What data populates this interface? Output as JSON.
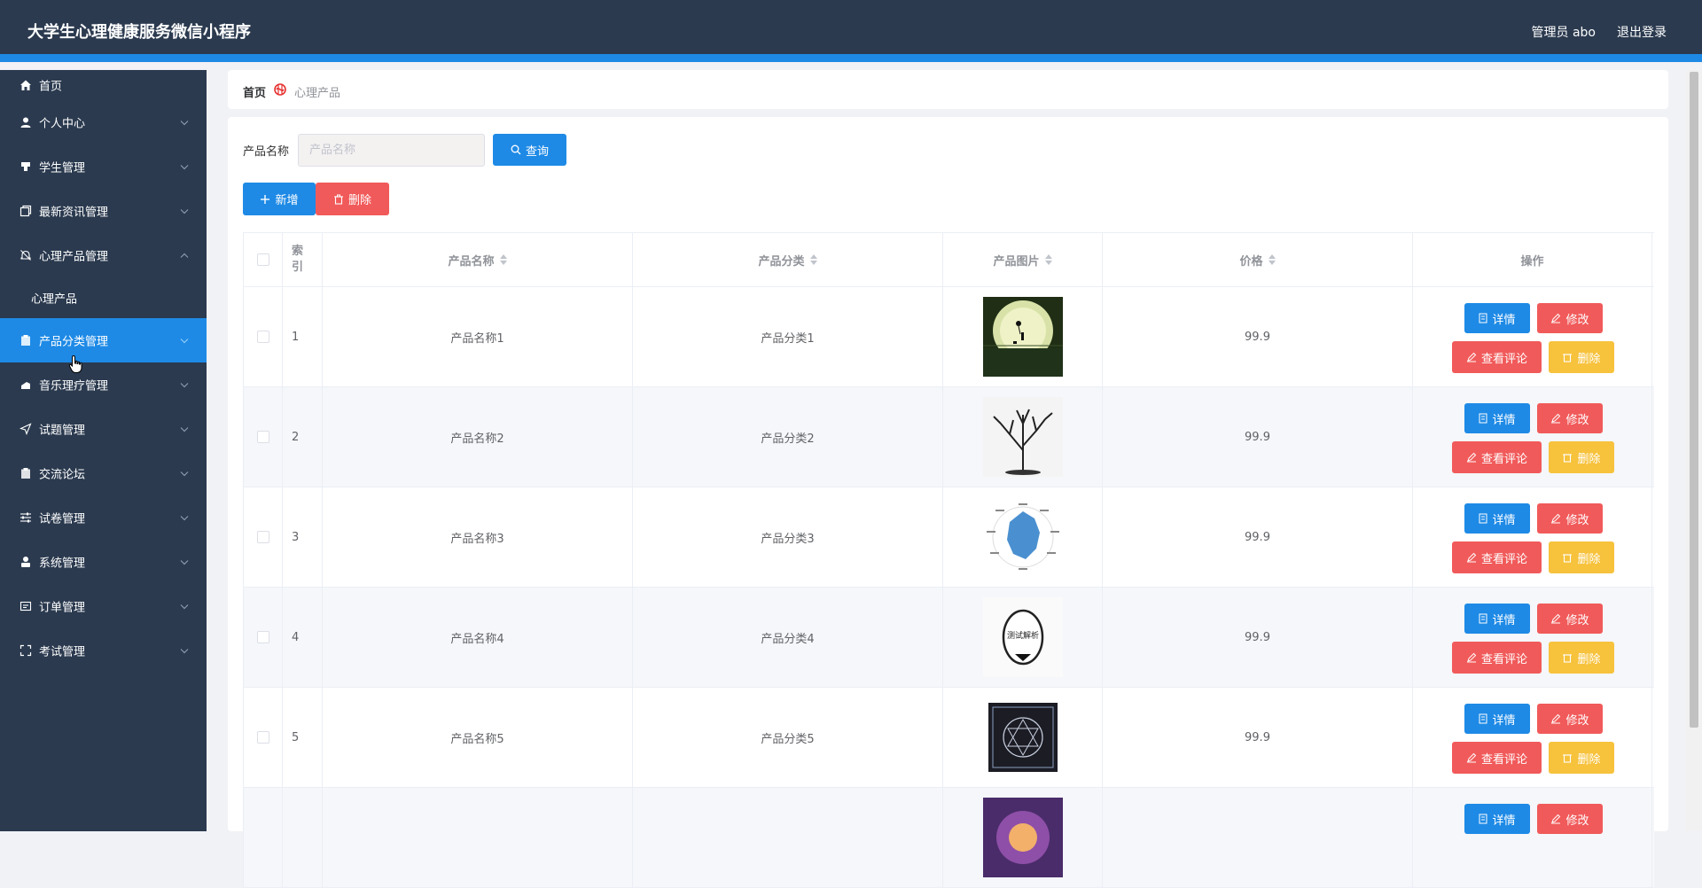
{
  "header": {
    "app_title": "大学生心理健康服务微信小程序",
    "admin_label": "管理员 abo",
    "logout_label": "退出登录"
  },
  "sidebar": {
    "items": [
      {
        "label": "首页",
        "icon": "home-icon"
      },
      {
        "label": "个人中心",
        "icon": "user-icon"
      },
      {
        "label": "学生管理",
        "icon": "student-icon"
      },
      {
        "label": "最新资讯管理",
        "icon": "news-icon"
      },
      {
        "label": "心理产品管理",
        "icon": "bell-icon"
      },
      {
        "label": "产品分类管理",
        "icon": "clipboard-icon"
      },
      {
        "label": "音乐理疗管理",
        "icon": "music-icon"
      },
      {
        "label": "试题管理",
        "icon": "send-icon"
      },
      {
        "label": "交流论坛",
        "icon": "clipboard-icon"
      },
      {
        "label": "试卷管理",
        "icon": "sliders-icon"
      },
      {
        "label": "系统管理",
        "icon": "person-icon"
      },
      {
        "label": "订单管理",
        "icon": "order-icon"
      },
      {
        "label": "考试管理",
        "icon": "fullscreen-icon"
      }
    ],
    "sub_item": "心理产品",
    "active_item": "产品分类管理"
  },
  "breadcrumb": {
    "home": "首页",
    "current": "心理产品"
  },
  "search": {
    "label": "产品名称",
    "placeholder": "产品名称",
    "value": "",
    "query_button": "查询"
  },
  "actions": {
    "add_button": "新增",
    "delete_button": "删除"
  },
  "table": {
    "headers": {
      "index": "索引",
      "name": "产品名称",
      "category": "产品分类",
      "image": "产品图片",
      "price": "价格",
      "ops": "操作"
    },
    "rows": [
      {
        "index": "1",
        "name": "产品名称1",
        "category": "产品分类1",
        "price": "99.9",
        "image": "moon-silhouette"
      },
      {
        "index": "2",
        "name": "产品名称2",
        "category": "产品分类2",
        "price": "99.9",
        "image": "bare-tree"
      },
      {
        "index": "3",
        "name": "产品名称3",
        "category": "产品分类3",
        "price": "99.9",
        "image": "radar-chart"
      },
      {
        "index": "4",
        "name": "产品名称4",
        "category": "产品分类4",
        "price": "99.9",
        "image": "test-analysis-badge",
        "image_text": "测试解析"
      },
      {
        "index": "5",
        "name": "产品名称5",
        "category": "产品分类5",
        "price": "99.9",
        "image": "mandala-cloth"
      }
    ],
    "row_buttons": {
      "detail": "详情",
      "edit": "修改",
      "review": "查看评论",
      "remove": "删除"
    }
  },
  "colors": {
    "topbar": "#2b3a4f",
    "accent": "#1e8ae6",
    "danger": "#f15a5a",
    "warning": "#f7c23c"
  }
}
